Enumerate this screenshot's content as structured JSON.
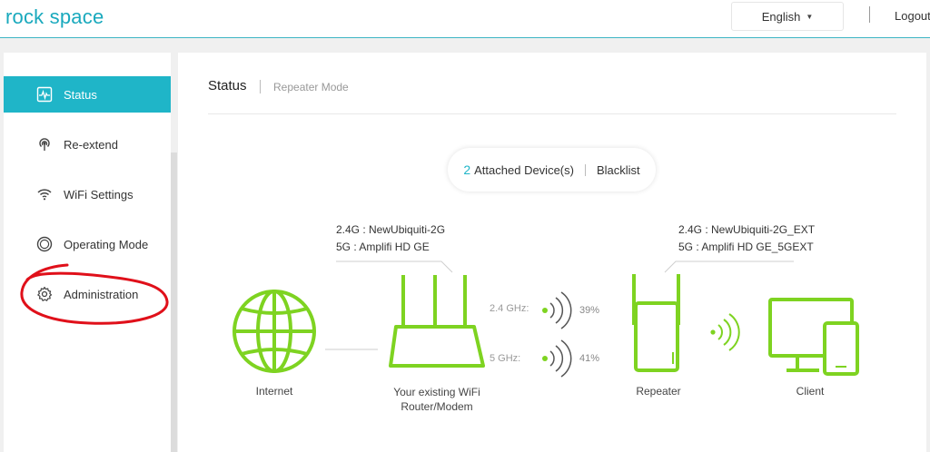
{
  "header": {
    "logo": "rock space",
    "language": "English",
    "logout": "Logout"
  },
  "sidebar": {
    "items": [
      {
        "label": "Status",
        "icon": "activity-icon",
        "active": true
      },
      {
        "label": "Re-extend",
        "icon": "signal-tower-icon",
        "active": false
      },
      {
        "label": "WiFi Settings",
        "icon": "wifi-icon",
        "active": false
      },
      {
        "label": "Operating Mode",
        "icon": "mode-ring-icon",
        "active": false
      },
      {
        "label": "Administration",
        "icon": "gear-icon",
        "active": false
      }
    ]
  },
  "main": {
    "title": "Status",
    "subtitle": "Repeater Mode",
    "attached": {
      "count": "2",
      "label": "Attached Device(s)",
      "blacklist": "Blacklist"
    },
    "router_ssid": {
      "band24": "2.4G : NewUbiquiti-2G",
      "band5": "5G : Amplifi HD GE"
    },
    "repeater_ssid": {
      "band24": "2.4G : NewUbiquiti-2G_EXT",
      "band5": "5G : Amplifi HD GE_5GEXT"
    },
    "signals": [
      {
        "band": "2.4 GHz:",
        "strength": "39%"
      },
      {
        "band": "5 GHz:",
        "strength": "41%"
      }
    ],
    "nodes": {
      "internet": "Internet",
      "router_line1": "Your existing WiFi",
      "router_line2": "Router/Modem",
      "repeater": "Repeater",
      "client": "Client"
    }
  },
  "colors": {
    "accent": "#1fb5c8",
    "device_green": "#7ed321",
    "annotation_red": "#e0101a"
  }
}
